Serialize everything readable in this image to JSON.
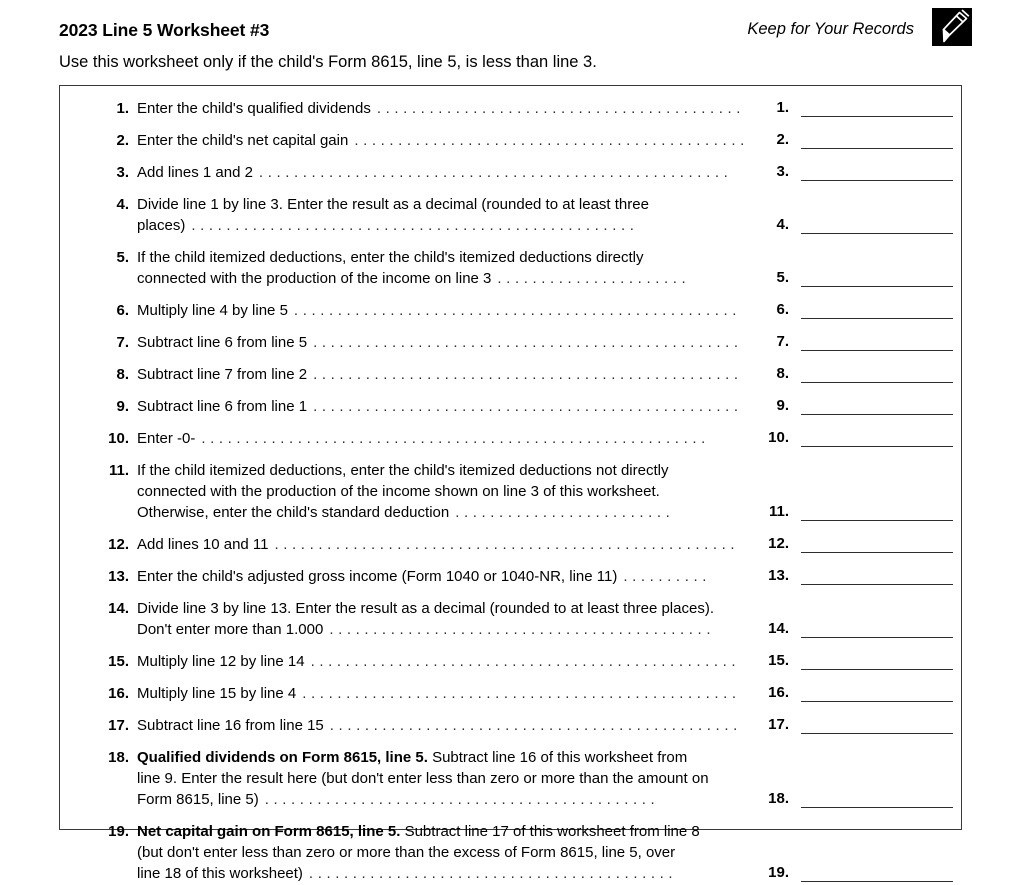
{
  "header": {
    "title": "2023 Line 5 Worksheet #3",
    "subtitle": "Use this worksheet only if the child's Form 8615, line 5, is less than line 3.",
    "keep_for_records": "Keep for Your Records",
    "badge_icon": "pen-icon"
  },
  "worksheet": {
    "leader_dot": ".",
    "lines": [
      {
        "number": "1.",
        "answer_number": "1.",
        "text_lines": [
          "Enter the child's qualified dividends"
        ],
        "leader_dots": 42,
        "answer_value": ""
      },
      {
        "number": "2.",
        "answer_number": "2.",
        "text_lines": [
          "Enter the child's net capital gain"
        ],
        "leader_dots": 45,
        "answer_value": ""
      },
      {
        "number": "3.",
        "answer_number": "3.",
        "text_lines": [
          "Add lines 1 and 2"
        ],
        "leader_dots": 54,
        "answer_value": ""
      },
      {
        "number": "4.",
        "answer_number": "4.",
        "text_lines": [
          "Divide line 1 by line 3. Enter the result as a decimal (rounded to at least three",
          "places)"
        ],
        "leader_dots": 51,
        "answer_value": ""
      },
      {
        "number": "5.",
        "answer_number": "5.",
        "text_lines": [
          "If the child itemized deductions, enter the child's itemized deductions directly",
          "connected with the production of the income on line 3"
        ],
        "leader_dots": 22,
        "answer_value": ""
      },
      {
        "number": "6.",
        "answer_number": "6.",
        "text_lines": [
          "Multiply line 4 by line 5"
        ],
        "leader_dots": 51,
        "answer_value": ""
      },
      {
        "number": "7.",
        "answer_number": "7.",
        "text_lines": [
          "Subtract line 6 from line 5"
        ],
        "leader_dots": 49,
        "answer_value": ""
      },
      {
        "number": "8.",
        "answer_number": "8.",
        "text_lines": [
          "Subtract line 7 from line 2"
        ],
        "leader_dots": 49,
        "answer_value": ""
      },
      {
        "number": "9.",
        "answer_number": "9.",
        "text_lines": [
          "Subtract line 6 from line 1"
        ],
        "leader_dots": 49,
        "answer_value": ""
      },
      {
        "number": "10.",
        "answer_number": "10.",
        "text_lines": [
          "Enter -0-"
        ],
        "leader_dots": 58,
        "answer_value": ""
      },
      {
        "number": "11.",
        "answer_number": "11.",
        "text_lines": [
          "If the child itemized deductions, enter the child's itemized deductions not directly",
          "connected with the production of the income shown on line 3 of this worksheet.",
          "Otherwise, enter the child's standard deduction"
        ],
        "leader_dots": 25,
        "answer_value": ""
      },
      {
        "number": "12.",
        "answer_number": "12.",
        "text_lines": [
          "Add lines 10 and 11"
        ],
        "leader_dots": 53,
        "answer_value": ""
      },
      {
        "number": "13.",
        "answer_number": "13.",
        "text_lines": [
          "Enter the child's adjusted gross income (Form 1040 or 1040-NR, line 11)"
        ],
        "leader_dots": 10,
        "answer_value": ""
      },
      {
        "number": "14.",
        "answer_number": "14.",
        "text_lines": [
          "Divide line 3 by line 13. Enter the result as a decimal (rounded to at least three places).",
          "Don't enter more than 1.000"
        ],
        "leader_dots": 44,
        "answer_value": ""
      },
      {
        "number": "15.",
        "answer_number": "15.",
        "text_lines": [
          "Multiply line 12 by line 14"
        ],
        "leader_dots": 49,
        "answer_value": ""
      },
      {
        "number": "16.",
        "answer_number": "16.",
        "text_lines": [
          "Multiply line 15 by line 4"
        ],
        "leader_dots": 50,
        "answer_value": ""
      },
      {
        "number": "17.",
        "answer_number": "17.",
        "text_lines": [
          "Subtract line 16 from line 15"
        ],
        "leader_dots": 47,
        "answer_value": ""
      },
      {
        "number": "18.",
        "answer_number": "18.",
        "bold_lead": "Qualified dividends on Form 8615, line 5.",
        "text_lines": [
          " Subtract line 16 of this worksheet from",
          "line 9. Enter the result here (but don't enter less than zero or more than the amount on",
          "Form 8615, line 5)"
        ],
        "leader_dots": 45,
        "answer_value": ""
      },
      {
        "number": "19.",
        "answer_number": "19.",
        "bold_lead": "Net capital gain on Form 8615, line 5.",
        "text_lines": [
          " Subtract line 17 of this worksheet from line 8",
          "(but don't enter less than zero or more than the excess of Form 8615, line 5, over",
          "line 18 of this worksheet)"
        ],
        "leader_dots": 42,
        "answer_value": ""
      }
    ]
  }
}
